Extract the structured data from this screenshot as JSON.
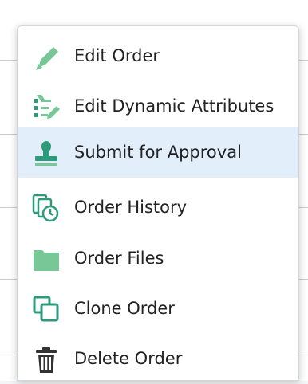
{
  "context_menu": {
    "items": [
      {
        "label": "Edit Order",
        "icon": "pencil-icon"
      },
      {
        "label": "Edit Dynamic Attributes",
        "icon": "attributes-edit-icon"
      },
      {
        "label": "Submit for Approval",
        "icon": "stamp-icon",
        "highlighted": true
      },
      {
        "label": "Order History",
        "icon": "history-icon"
      },
      {
        "label": "Order Files",
        "icon": "folder-icon"
      },
      {
        "label": "Clone Order",
        "icon": "clone-icon"
      },
      {
        "label": "Delete Order",
        "icon": "trash-icon"
      }
    ]
  },
  "colors": {
    "icon_green": "#6fc08f",
    "icon_teal": "#2e9a7a",
    "highlight": "#e3eefb",
    "text": "#222222"
  }
}
